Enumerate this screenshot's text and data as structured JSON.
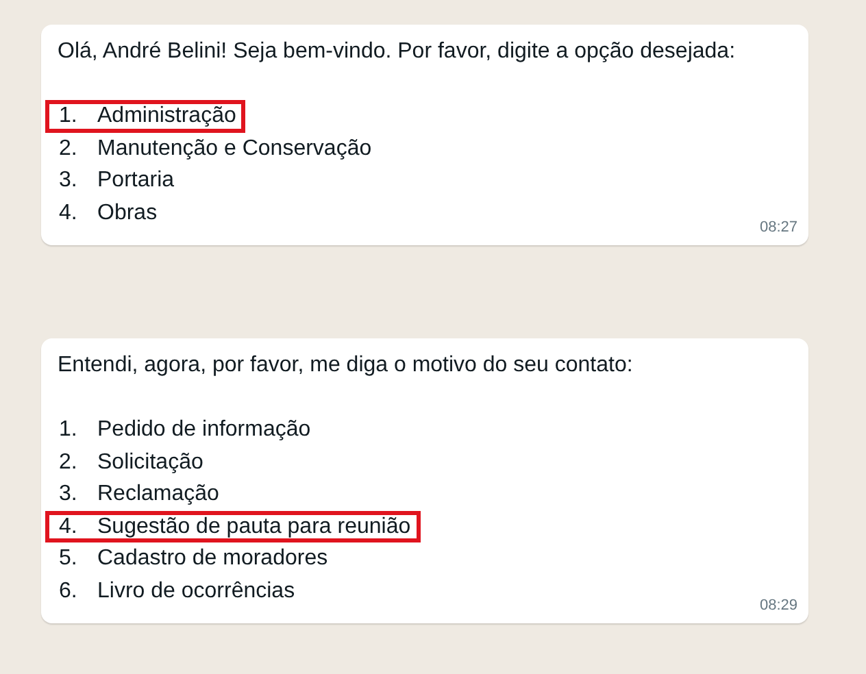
{
  "messages": [
    {
      "text": "Olá, André Belini! Seja bem-vindo. Por favor, digite a opção desejada:",
      "time": "08:27",
      "options": [
        {
          "number": "1.",
          "label": "Administração",
          "highlighted": true
        },
        {
          "number": "2.",
          "label": "Manutenção e Conservação",
          "highlighted": false
        },
        {
          "number": "3.",
          "label": "Portaria",
          "highlighted": false
        },
        {
          "number": "4.",
          "label": "Obras",
          "highlighted": false
        }
      ]
    },
    {
      "text": "Entendi, agora, por favor, me diga o motivo do seu contato:",
      "time": "08:29",
      "options": [
        {
          "number": "1.",
          "label": "Pedido de informação",
          "highlighted": false
        },
        {
          "number": "2.",
          "label": "Solicitação",
          "highlighted": false
        },
        {
          "number": "3.",
          "label": "Reclamação",
          "highlighted": false
        },
        {
          "number": "4.",
          "label": "Sugestão de pauta para reunião",
          "highlighted": true
        },
        {
          "number": "5.",
          "label": "Cadastro de moradores",
          "highlighted": false
        },
        {
          "number": "6.",
          "label": "Livro de ocorrências",
          "highlighted": false
        }
      ]
    }
  ]
}
